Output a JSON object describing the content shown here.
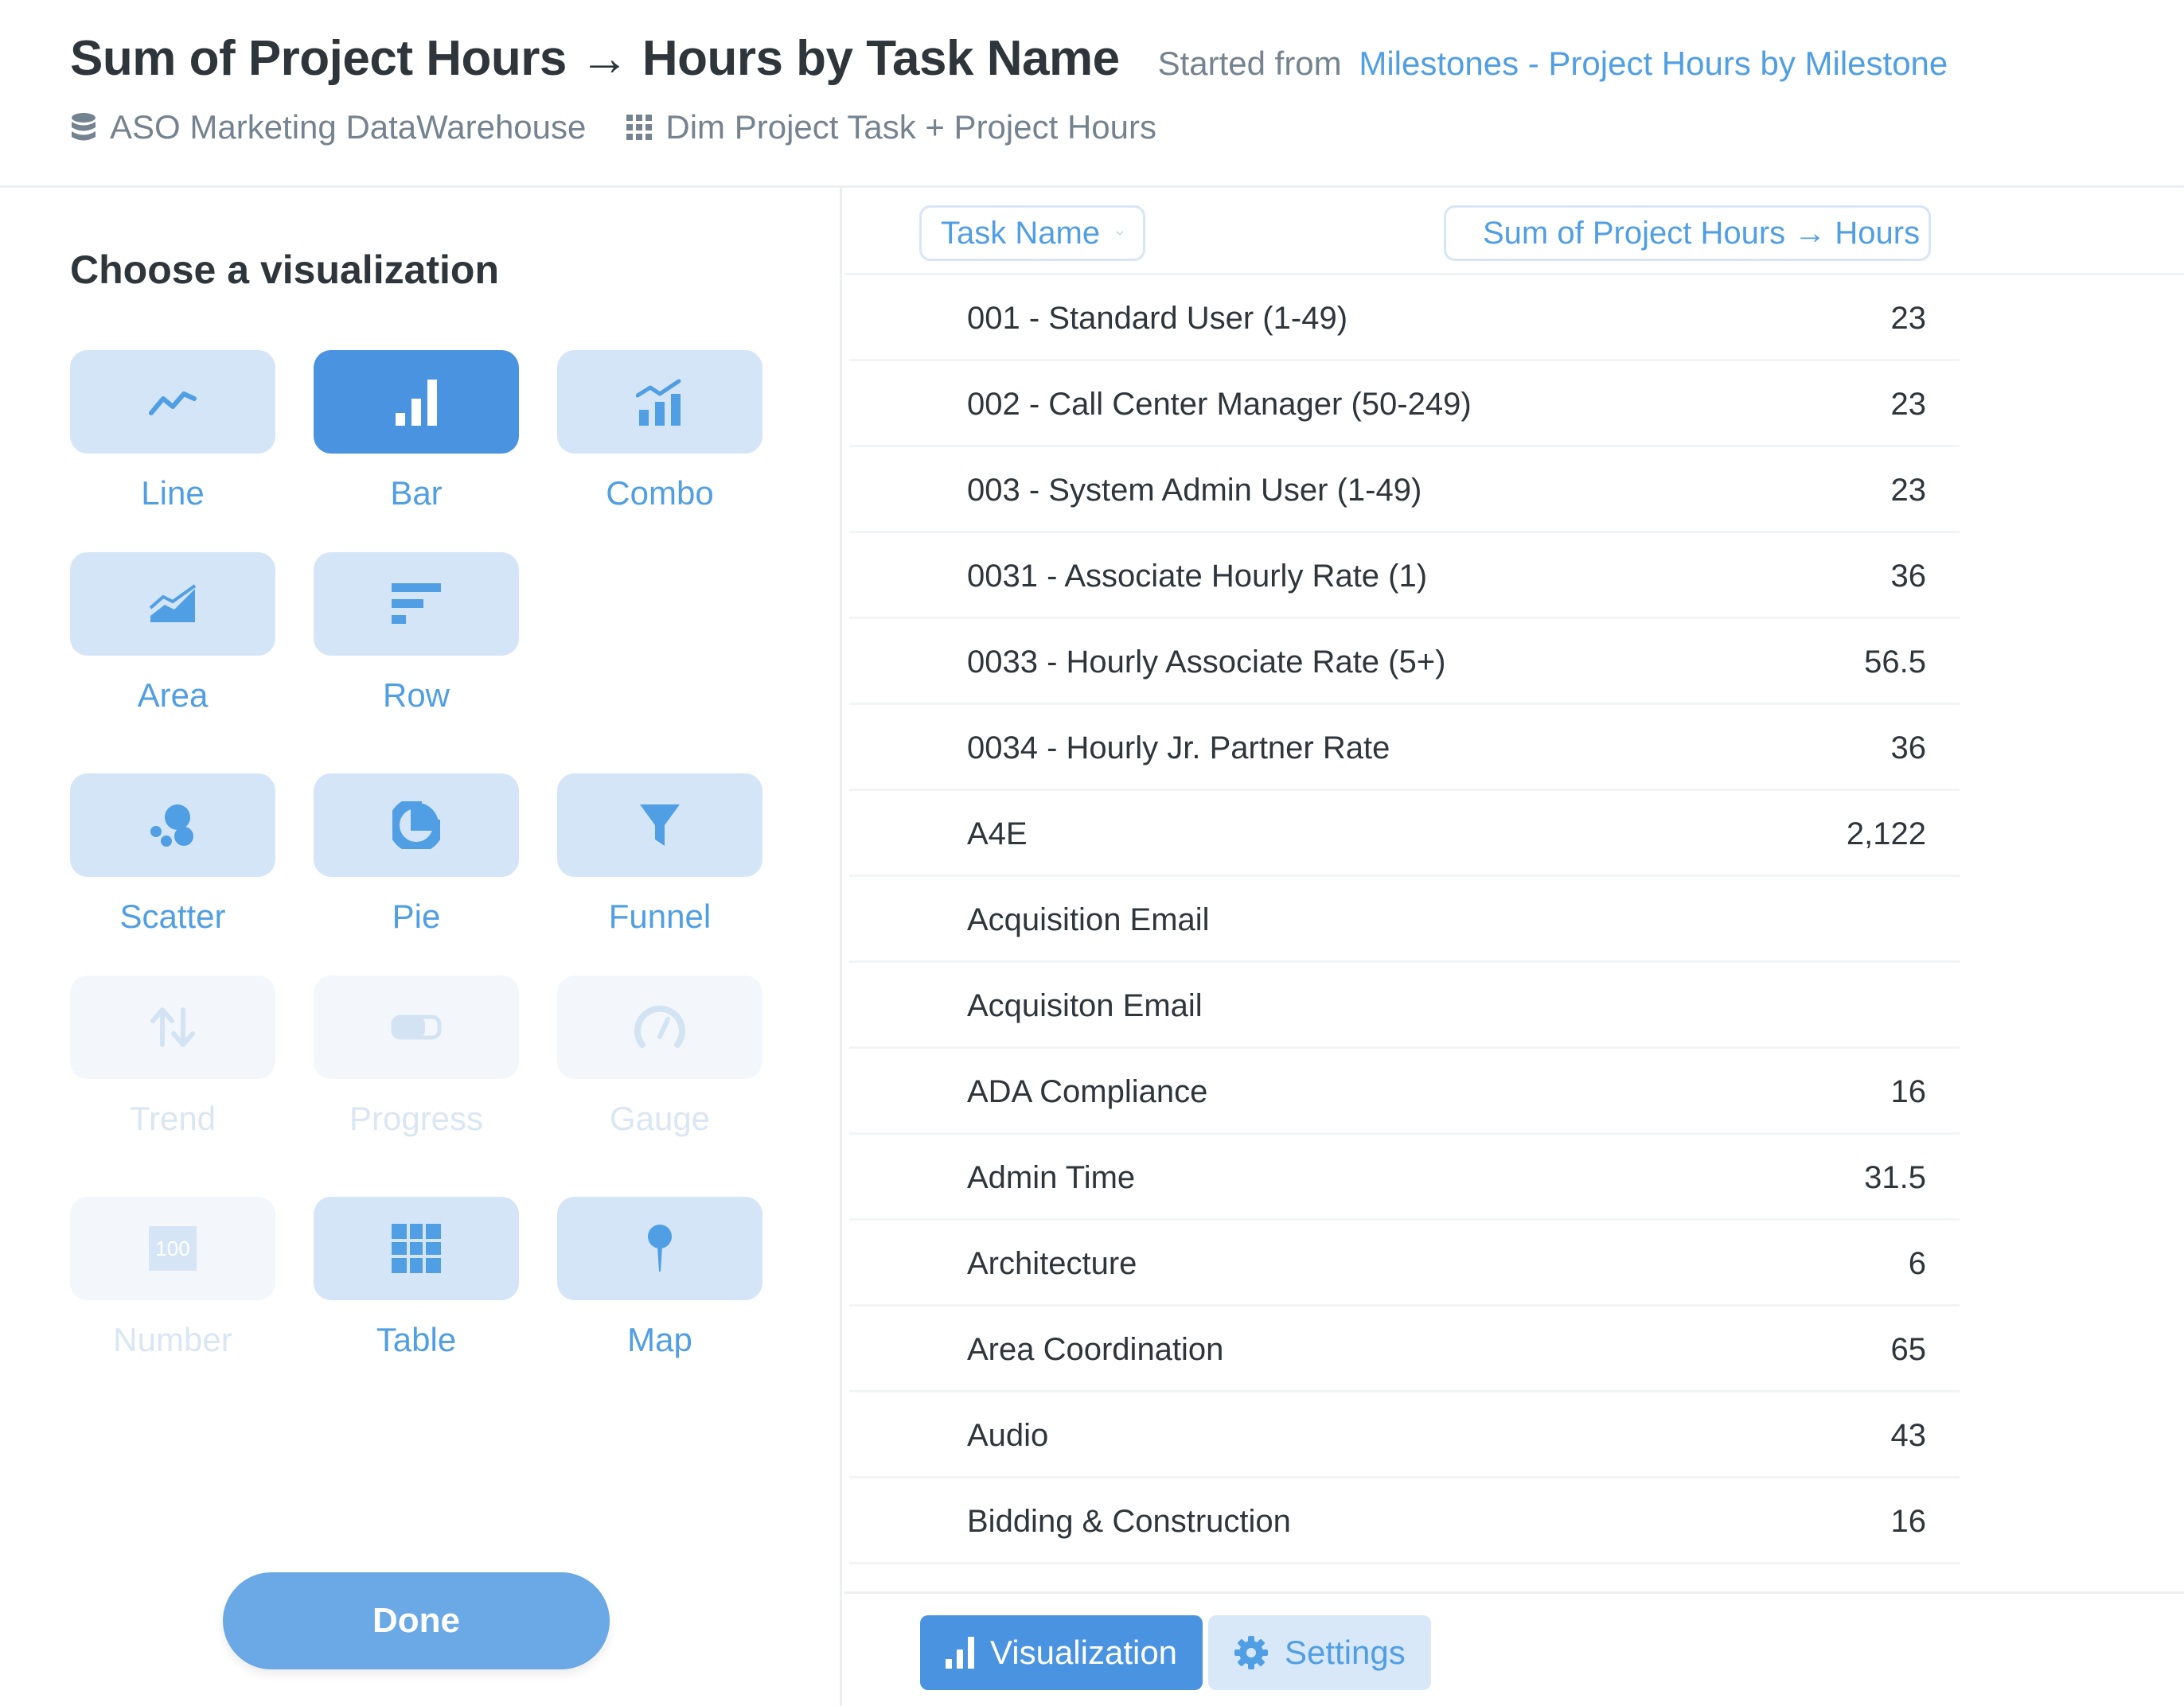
{
  "header": {
    "title": "Sum of Project Hours → Hours by Task Name",
    "started_from_label": "Started from",
    "started_from_link": "Milestones - Project Hours by Milestone",
    "database": "ASO Marketing DataWarehouse",
    "table": "Dim Project Task + Project Hours"
  },
  "sidebar": {
    "title": "Choose a visualization",
    "visualizations": [
      {
        "label": "Line",
        "icon": "line-chart-icon",
        "state": "enabled"
      },
      {
        "label": "Bar",
        "icon": "bar-chart-icon",
        "state": "active"
      },
      {
        "label": "Combo",
        "icon": "combo-chart-icon",
        "state": "enabled"
      },
      {
        "label": "Area",
        "icon": "area-chart-icon",
        "state": "enabled"
      },
      {
        "label": "Row",
        "icon": "row-chart-icon",
        "state": "enabled"
      },
      {
        "label": "Scatter",
        "icon": "scatter-chart-icon",
        "state": "enabled"
      },
      {
        "label": "Pie",
        "icon": "pie-chart-icon",
        "state": "enabled"
      },
      {
        "label": "Funnel",
        "icon": "funnel-icon",
        "state": "enabled"
      },
      {
        "label": "Trend",
        "icon": "trend-icon",
        "state": "disabled"
      },
      {
        "label": "Progress",
        "icon": "progress-icon",
        "state": "disabled"
      },
      {
        "label": "Gauge",
        "icon": "gauge-icon",
        "state": "disabled"
      },
      {
        "label": "Number",
        "icon": "number-icon",
        "state": "disabled",
        "icon_text": "100"
      },
      {
        "label": "Table",
        "icon": "table-icon",
        "state": "enabled"
      },
      {
        "label": "Map",
        "icon": "map-pin-icon",
        "state": "enabled"
      }
    ],
    "done_label": "Done"
  },
  "table": {
    "columns": [
      "Task Name",
      "Sum of Project Hours → Hours"
    ],
    "rows": [
      {
        "task": "001 - Standard User (1-49)",
        "hours": "23"
      },
      {
        "task": "002 - Call Center Manager (50-249)",
        "hours": "23"
      },
      {
        "task": "003 - System Admin User (1-49)",
        "hours": "23"
      },
      {
        "task": "0031 - Associate Hourly Rate (1)",
        "hours": "36"
      },
      {
        "task": "0033 - Hourly Associate Rate (5+)",
        "hours": "56.5"
      },
      {
        "task": "0034 - Hourly Jr. Partner Rate",
        "hours": "36"
      },
      {
        "task": "A4E",
        "hours": "2,122"
      },
      {
        "task": "Acquisition Email",
        "hours": ""
      },
      {
        "task": "Acquisiton Email",
        "hours": ""
      },
      {
        "task": "ADA Compliance",
        "hours": "16"
      },
      {
        "task": "Admin Time",
        "hours": "31.5"
      },
      {
        "task": "Architecture",
        "hours": "6"
      },
      {
        "task": "Area Coordination",
        "hours": "65"
      },
      {
        "task": "Audio",
        "hours": "43"
      },
      {
        "task": "Bidding & Construction",
        "hours": "16"
      }
    ]
  },
  "footer": {
    "visualization_label": "Visualization",
    "settings_label": "Settings"
  },
  "colors": {
    "accent": "#509ee3",
    "active_tile": "#4a93e0",
    "tile": "#d4e5f8",
    "disabled_tile": "#f3f7fc"
  }
}
